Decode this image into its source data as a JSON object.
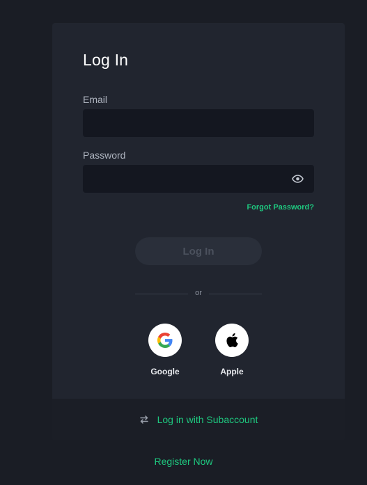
{
  "form": {
    "title": "Log In",
    "email_label": "Email",
    "email_value": "",
    "password_label": "Password",
    "password_value": "",
    "password_toggle_icon": "eye-icon",
    "forgot_password": "Forgot Password?",
    "submit_label": "Log In",
    "divider_text": "or"
  },
  "social": [
    {
      "label": "Google",
      "icon": "google-icon"
    },
    {
      "label": "Apple",
      "icon": "apple-icon"
    }
  ],
  "subaccount": {
    "icon": "swap-arrows-icon",
    "label": "Log in with Subaccount"
  },
  "register_label": "Register Now",
  "colors": {
    "accent": "#1ec87f",
    "card_bg": "#21252f",
    "page_bg": "#1a1d25",
    "input_bg": "#141720",
    "disabled_button_bg": "#2a2f3a"
  }
}
